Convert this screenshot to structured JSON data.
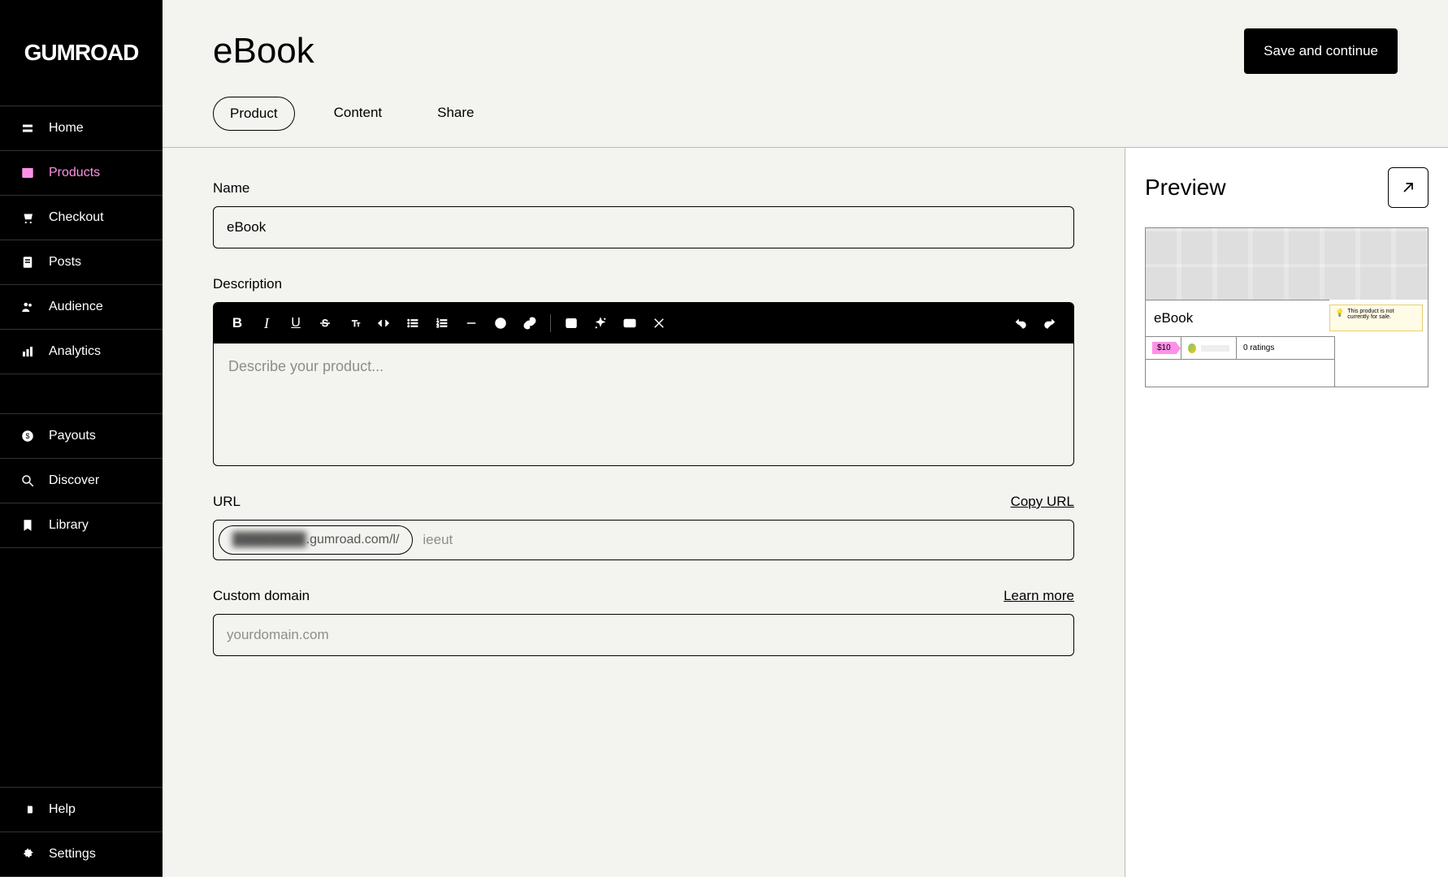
{
  "brand": "GUMROAD",
  "sidebar": {
    "items": [
      {
        "label": "Home",
        "icon": "home-icon"
      },
      {
        "label": "Products",
        "icon": "products-icon",
        "active": true
      },
      {
        "label": "Checkout",
        "icon": "checkout-icon"
      },
      {
        "label": "Posts",
        "icon": "posts-icon"
      },
      {
        "label": "Audience",
        "icon": "audience-icon"
      },
      {
        "label": "Analytics",
        "icon": "analytics-icon"
      }
    ],
    "items_lower": [
      {
        "label": "Payouts",
        "icon": "payouts-icon"
      },
      {
        "label": "Discover",
        "icon": "discover-icon"
      },
      {
        "label": "Library",
        "icon": "library-icon"
      }
    ],
    "items_footer": [
      {
        "label": "Help",
        "icon": "help-icon"
      },
      {
        "label": "Settings",
        "icon": "settings-icon"
      }
    ]
  },
  "header": {
    "title": "eBook",
    "save_button": "Save and continue",
    "tabs": [
      {
        "label": "Product",
        "active": true
      },
      {
        "label": "Content"
      },
      {
        "label": "Share"
      }
    ]
  },
  "form": {
    "name": {
      "label": "Name",
      "value": "eBook"
    },
    "description": {
      "label": "Description",
      "placeholder": "Describe your product..."
    },
    "url": {
      "label": "URL",
      "copy_link": "Copy URL",
      "prefix": ".gumroad.com/l/",
      "slug": "ieeut"
    },
    "custom_domain": {
      "label": "Custom domain",
      "learn_more": "Learn more",
      "placeholder": "yourdomain.com"
    }
  },
  "preview": {
    "title": "Preview",
    "card": {
      "product_name": "eBook",
      "price": "$10",
      "ratings": "0 ratings",
      "warning": "This product is not currently for sale."
    }
  }
}
